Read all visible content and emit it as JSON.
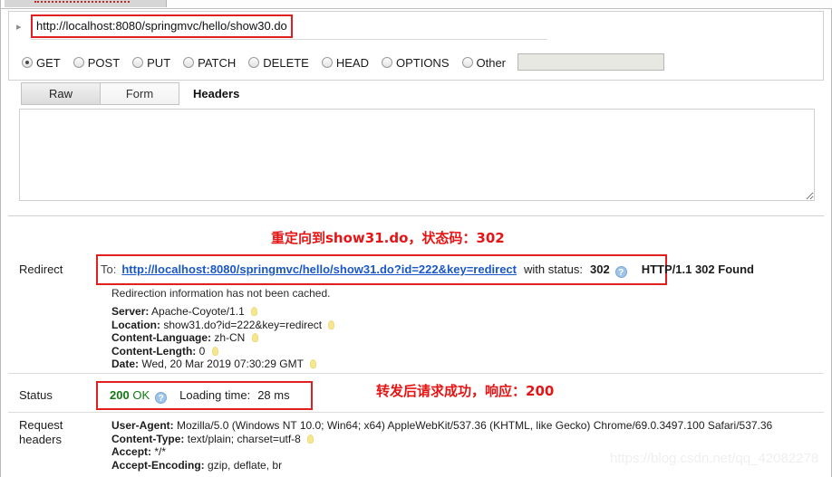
{
  "window": {
    "tab_label": ""
  },
  "request": {
    "url_value": "http://localhost:8080/springmvc/hello/show30.do",
    "url_placeholder": "http://",
    "disclosure_icon": "triangle-right-icon",
    "methods": [
      {
        "label": "GET",
        "selected": true
      },
      {
        "label": "POST",
        "selected": false
      },
      {
        "label": "PUT",
        "selected": false
      },
      {
        "label": "PATCH",
        "selected": false
      },
      {
        "label": "DELETE",
        "selected": false
      },
      {
        "label": "HEAD",
        "selected": false
      },
      {
        "label": "OPTIONS",
        "selected": false
      },
      {
        "label": "Other",
        "selected": false
      }
    ],
    "other_value": "",
    "tabs": {
      "raw": "Raw",
      "form": "Form",
      "headers": "Headers"
    },
    "body_value": ""
  },
  "response": {
    "redirect": {
      "label": "Redirect",
      "to_label": "To:",
      "url": "http://localhost:8080/springmvc/hello/show31.do?id=222&key=redirect",
      "with_status_label": "with status:",
      "status_code": "302",
      "help_icon": "?",
      "status_line": "HTTP/1.1 302 Found",
      "cache_note": "Redirection information has not been cached.",
      "headers": [
        {
          "name": "Server:",
          "value": "Apache-Coyote/1.1",
          "bulb": true
        },
        {
          "name": "Location:",
          "value": "show31.do?id=222&key=redirect",
          "bulb": true
        },
        {
          "name": "Content-Language:",
          "value": "zh-CN",
          "bulb": true
        },
        {
          "name": "Content-Length:",
          "value": "0",
          "bulb": true
        },
        {
          "name": "Date:",
          "value": "Wed, 20 Mar 2019 07:30:29 GMT",
          "bulb": true
        }
      ]
    },
    "status": {
      "label": "Status",
      "code": "200",
      "text": "OK",
      "help_icon": "?",
      "loading_label": "Loading time:",
      "loading_value": "28 ms"
    },
    "request_headers": {
      "label_line1": "Request",
      "label_line2": "headers",
      "headers": [
        {
          "name": "User-Agent:",
          "value": "Mozilla/5.0 (Windows NT 10.0; Win64; x64) AppleWebKit/537.36 (KHTML, like Gecko) Chrome/69.0.3497.100 Safari/537.36",
          "bulb": false
        },
        {
          "name": "Content-Type:",
          "value": "text/plain; charset=utf-8",
          "bulb": true
        },
        {
          "name": "Accept:",
          "value": "*/*",
          "bulb": false
        },
        {
          "name": "Accept-Encoding:",
          "value": "gzip, deflate, br",
          "bulb": false
        }
      ]
    }
  },
  "annotations": [
    {
      "text": "重定向到show31.do，状态码：302",
      "color": "#e51515"
    },
    {
      "text": "转发后请求成功，响应：200",
      "color": "#e51515"
    }
  ],
  "watermark": "https://blog.csdn.net/qq_42082278"
}
